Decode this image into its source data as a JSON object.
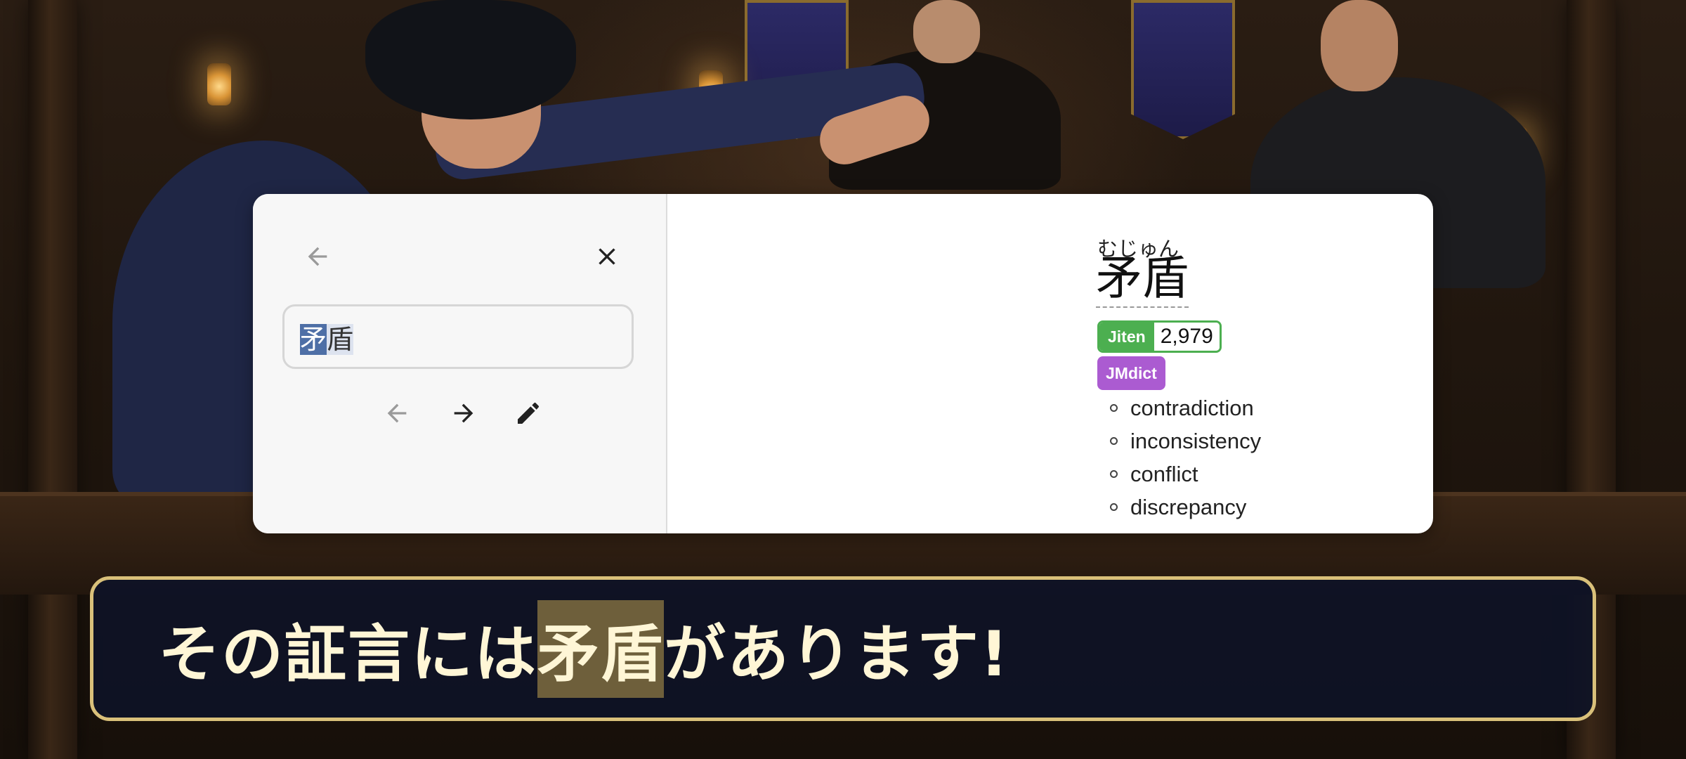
{
  "popup": {
    "search": {
      "value_selected": "矛",
      "value_rest": "盾"
    },
    "entry": {
      "reading": "むじゅん",
      "headword": "矛盾",
      "frequency": {
        "source": "Jiten",
        "value": "2,979",
        "color": "#4caf50"
      },
      "dictionary": {
        "name": "JMdict",
        "color": "#ab5bd1"
      },
      "glosses": [
        "contradiction",
        "inconsistency",
        "conflict",
        "discrepancy"
      ]
    },
    "icons": {
      "back": "arrow-left-icon",
      "close": "close-icon",
      "prev": "arrow-left-icon",
      "next": "arrow-right-icon",
      "edit": "pencil-icon",
      "audio": "speaker-icon",
      "clipboard": "clipboard-icon"
    }
  },
  "subtitle": {
    "before": "その証言には",
    "highlight": "矛盾",
    "after": "があります!"
  },
  "colors": {
    "subtitle_border": "#d9c07a",
    "subtitle_text": "#fff6d6",
    "accent_blue": "#1976d2"
  }
}
